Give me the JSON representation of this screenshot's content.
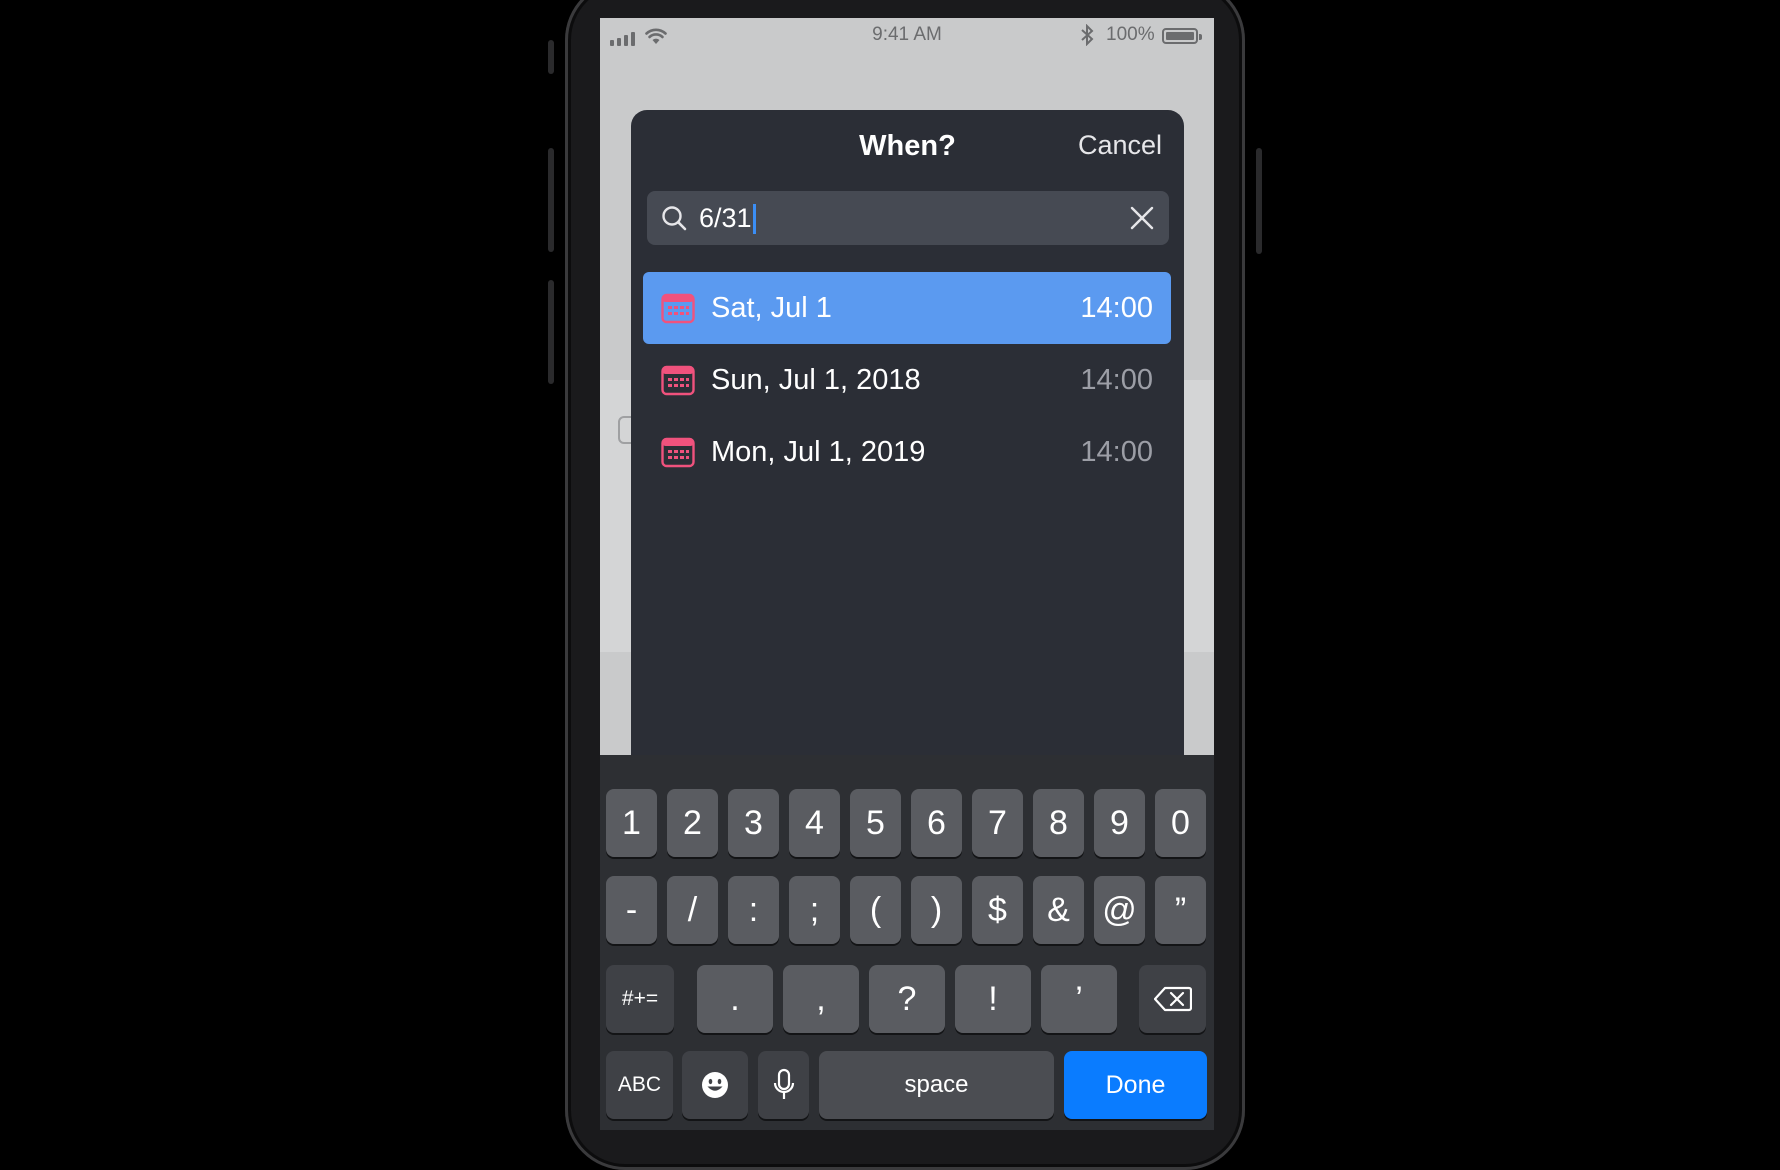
{
  "status_bar": {
    "time": "9:41 AM",
    "battery_percent": "100%"
  },
  "modal": {
    "title": "When?",
    "cancel_label": "Cancel",
    "search": {
      "value": "6/31"
    },
    "results": [
      {
        "date": "Sat, Jul 1",
        "time": "14:00",
        "selected": true
      },
      {
        "date": "Sun, Jul 1, 2018",
        "time": "14:00",
        "selected": false
      },
      {
        "date": "Mon, Jul 1, 2019",
        "time": "14:00",
        "selected": false
      }
    ]
  },
  "keyboard": {
    "row1": [
      "1",
      "2",
      "3",
      "4",
      "5",
      "6",
      "7",
      "8",
      "9",
      "0"
    ],
    "row2": [
      "-",
      "/",
      ":",
      ";",
      "(",
      ")",
      "$",
      "&",
      "@",
      "”"
    ],
    "row3": {
      "shift_label": "#+=",
      "keys": [
        ".",
        ",",
        "?",
        "!",
        "’"
      ]
    },
    "row4": {
      "abc_label": "ABC",
      "space_label": "space",
      "done_label": "Done"
    }
  },
  "colors": {
    "accent": "#0a7cff",
    "selection": "#5b9af0",
    "calendar_icon": "#f0527d",
    "modal_bg": "#2b2e36"
  }
}
